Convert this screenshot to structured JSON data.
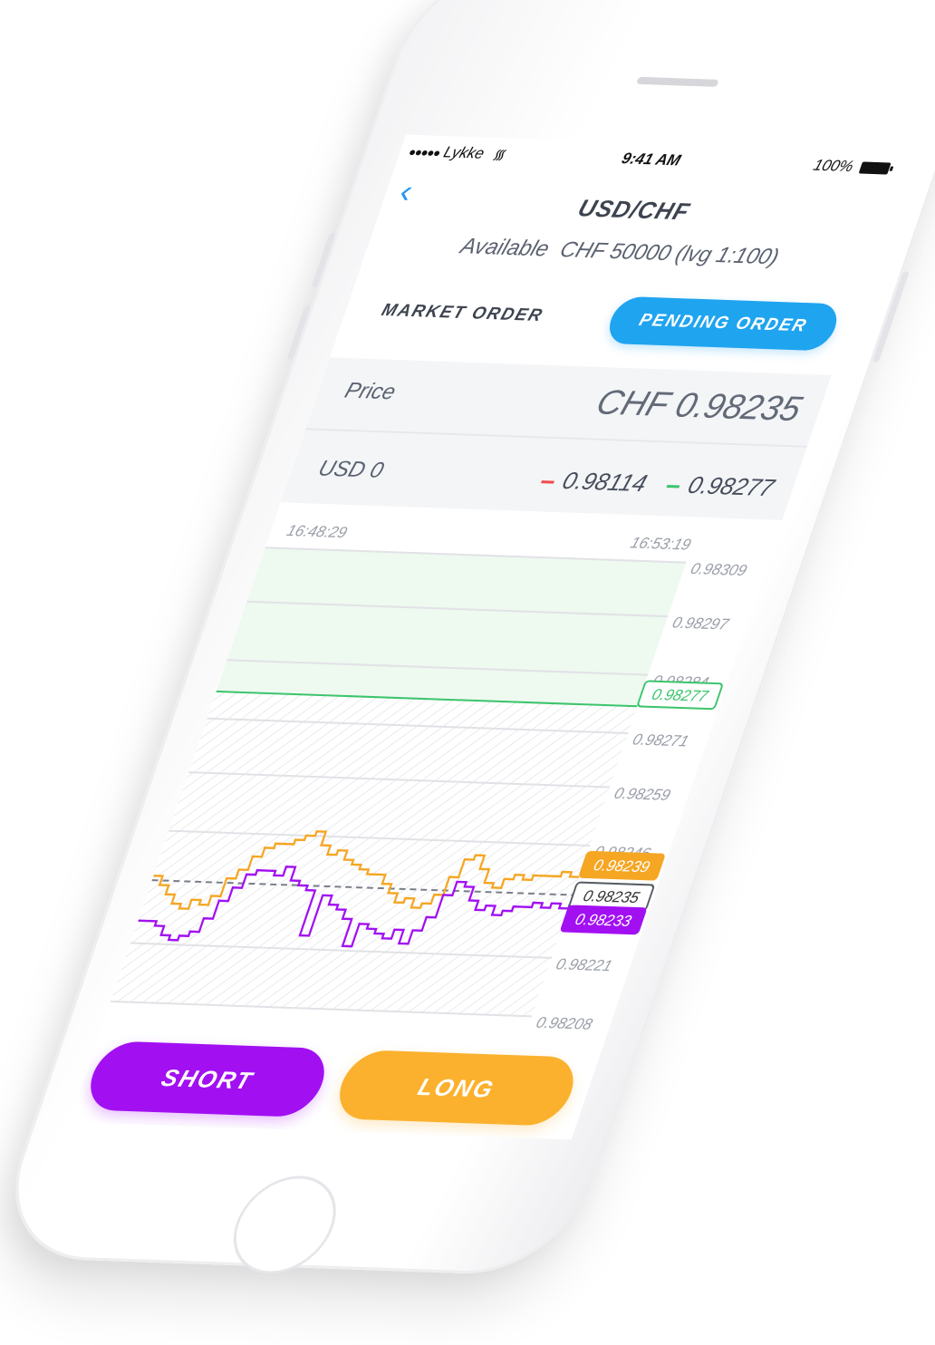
{
  "status_bar": {
    "carrier": "Lykke",
    "time": "9:41 AM",
    "battery": "100%"
  },
  "header": {
    "pair": "USD/CHF",
    "available_label": "Available",
    "available_value": "CHF 50000 (lvg 1:100)"
  },
  "tabs": {
    "market": "MARKET ORDER",
    "pending": "PENDING ORDER",
    "active": "pending"
  },
  "price_row": {
    "label": "Price",
    "value": "CHF 0.98235"
  },
  "amount_row": {
    "label": "USD 0",
    "bid": "0.98114",
    "ask": "0.98277"
  },
  "chart_data": {
    "type": "line",
    "time_start": "16:48:29",
    "time_end": "16:53:19",
    "ylim": [
      0.98208,
      0.98309
    ],
    "y_tick_labels": [
      "0.98309",
      "0.98297",
      "0.98284",
      "0.98271",
      "0.98259",
      "0.98246",
      "0.98221",
      "0.98208"
    ],
    "markers": {
      "ask_level": "0.98277",
      "long_price": "0.98239",
      "order_price": "0.98235",
      "short_price": "0.98233"
    },
    "series": [
      {
        "color": "#f5a623",
        "values": [
          0.98236,
          0.98234,
          0.98232,
          0.9823,
          0.98229,
          0.98231,
          0.9823,
          0.98232,
          0.98236,
          0.98238,
          0.98241,
          0.98243,
          0.98244,
          0.98244,
          0.98245,
          0.98246,
          0.98247,
          0.98244,
          0.98242,
          0.98243,
          0.98241,
          0.9824,
          0.98239,
          0.98238,
          0.98238,
          0.98236,
          0.98234,
          0.98232,
          0.98233,
          0.98231,
          0.98232,
          0.98234,
          0.98238,
          0.98242,
          0.98243,
          0.9824,
          0.98237,
          0.98236,
          0.98238,
          0.98239,
          0.98238,
          0.98239,
          0.98239,
          0.98239,
          0.9824,
          0.98239,
          0.98239
        ]
      },
      {
        "color": "#a210f2",
        "values": [
          0.98226,
          0.98226,
          0.98225,
          0.98223,
          0.98222,
          0.98223,
          0.98224,
          0.98227,
          0.98231,
          0.98234,
          0.98237,
          0.98238,
          0.98238,
          0.98237,
          0.98239,
          0.98236,
          0.98235,
          0.98234,
          0.98224,
          0.98233,
          0.98231,
          0.9823,
          0.98228,
          0.98222,
          0.98227,
          0.98226,
          0.98225,
          0.98224,
          0.98226,
          0.98223,
          0.98226,
          0.98229,
          0.98234,
          0.98237,
          0.98236,
          0.98233,
          0.98231,
          0.98232,
          0.9823,
          0.98231,
          0.98232,
          0.98232,
          0.98233,
          0.98232,
          0.98233,
          0.98232,
          0.98233
        ]
      }
    ]
  },
  "actions": {
    "short": "SHORT",
    "long": "LONG"
  },
  "colors": {
    "accent": "#1fa4f0",
    "short": "#a210f2",
    "long": "#fbb12d",
    "bid": "#f04a4a",
    "ask": "#3cc46c"
  }
}
